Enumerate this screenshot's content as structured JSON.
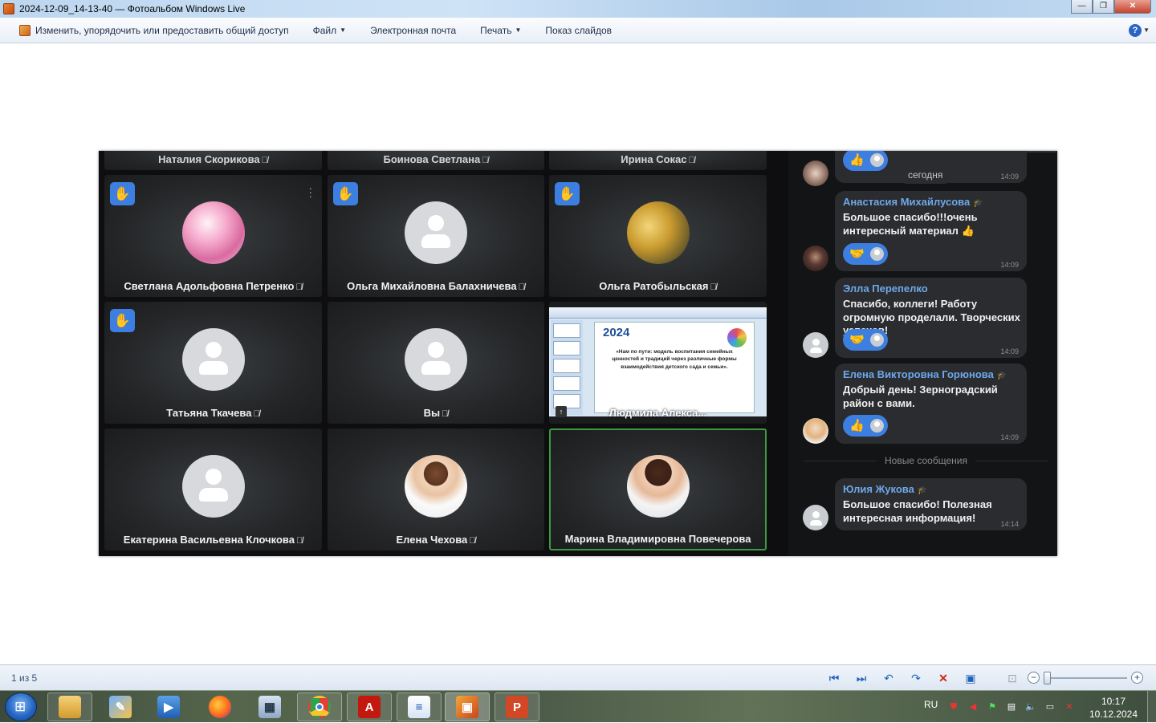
{
  "window": {
    "title": "2024-12-09_14-13-40 — Фотоальбом Windows Live",
    "minimize": "—",
    "maximize": "❐",
    "close": "✕"
  },
  "menu": {
    "items": [
      {
        "label": "Изменить, упорядочить или предоставить общий доступ"
      },
      {
        "label": "Файл",
        "caret": true
      },
      {
        "label": "Электронная почта"
      },
      {
        "label": "Печать",
        "caret": true
      },
      {
        "label": "Показ слайдов"
      }
    ],
    "help": "?"
  },
  "meeting": {
    "top_row_names": [
      "Наталия Скорикова",
      "Боинова Светлана",
      "Ирина Сокас"
    ],
    "tiles": [
      {
        "name": "Светлана Адольфовна Петренко",
        "hand": true,
        "muted": true,
        "avatar": "flower-photo"
      },
      {
        "name": "Ольга Михайловна Балахничева",
        "hand": true,
        "muted": true,
        "avatar": "default"
      },
      {
        "name": "Ольга Ратобыльская",
        "hand": true,
        "muted": true,
        "avatar": "autumn-photo"
      },
      {
        "name": "Татьяна Ткачева",
        "hand": true,
        "muted": true,
        "avatar": "default"
      },
      {
        "name": "Вы",
        "hand": false,
        "muted": true,
        "avatar": "default"
      },
      {
        "name": "Людмила Алекса...",
        "screen_share": true
      },
      {
        "name": "Екатерина Васильевна Клочкова",
        "hand": false,
        "muted": true,
        "avatar": "default"
      },
      {
        "name": "Елена Чехова",
        "hand": false,
        "muted": true,
        "avatar": "woman-photo"
      },
      {
        "name": "Марина Владимировна Повечерова",
        "hand": false,
        "muted": false,
        "avatar": "woman-photo-2",
        "active_speaker": true
      }
    ],
    "shared_slide": {
      "year": "2024",
      "title": "«Нам по пути: модель воспитания семейных ценностей и традиций через различные формы взаимодействия детского сада и семьи»."
    }
  },
  "chat": {
    "date_pill": "сегодня",
    "first_time": "14:09",
    "messages": [
      {
        "author": "Анастасия Михайлусова",
        "verified": true,
        "text": "Большое спасибо!!!очень интересный материал 👍",
        "reaction": "🤝",
        "time": "14:09"
      },
      {
        "author": "Элла Перепелко",
        "verified": false,
        "text": "Спасибо, коллеги! Работу огромную проделали. Творческих успехов!",
        "reaction": "🤝",
        "time": "14:09"
      },
      {
        "author": "Елена Викторовна Горюнова",
        "verified": true,
        "text": "Добрый день! Зерноградский район с вами.",
        "reaction": "👍",
        "time": "14:09"
      },
      {
        "author": "Юлия Жукова",
        "verified": true,
        "text": "Большое спасибо! Полезная интересная информация!",
        "reaction": "",
        "time": "14:14"
      }
    ],
    "new_messages_label": "Новые сообщения",
    "first_reaction": "👍"
  },
  "statusbar": {
    "counter": "1 из 5"
  },
  "taskbar": {
    "apps": [
      "explorer",
      "paint",
      "media-player",
      "firefox",
      "calculator",
      "chrome",
      "acrobat",
      "word-doc",
      "photo-gallery",
      "powerpoint"
    ],
    "language": "RU",
    "time": "10:17",
    "date": "10.12.2024"
  }
}
